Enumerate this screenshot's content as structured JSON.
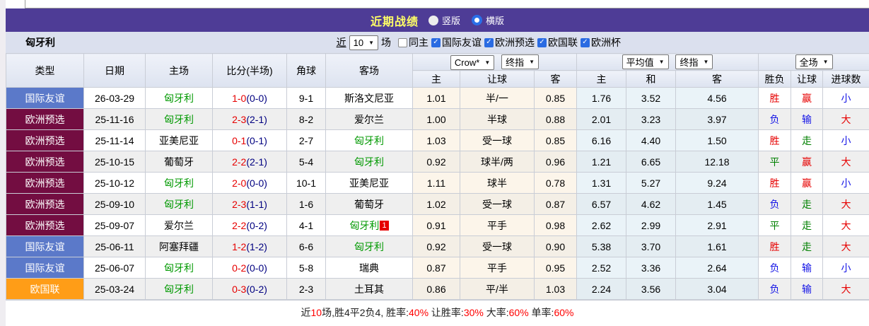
{
  "header": {
    "title": "近期战绩",
    "radio_vertical": "竖版",
    "radio_horizontal": "横版",
    "selected_mode": "横版"
  },
  "filter": {
    "team": "匈牙利",
    "near_label": "近",
    "games_value": "10",
    "games_suffix": "场",
    "checkboxes": [
      {
        "label": "同主",
        "checked": false
      },
      {
        "label": "国际友谊",
        "checked": true
      },
      {
        "label": "欧洲预选",
        "checked": true
      },
      {
        "label": "欧国联",
        "checked": true
      },
      {
        "label": "欧洲杯",
        "checked": true
      }
    ]
  },
  "table": {
    "team_name": "匈牙利",
    "static_headers": [
      "类型",
      "日期",
      "主场",
      "比分(半场)",
      "角球",
      "客场"
    ],
    "selects": {
      "crow_source": "Crow*",
      "crow_index": "终指",
      "avg_source": "平均值",
      "avg_index": "终指",
      "scope": "全场"
    },
    "sub_headers": [
      "主",
      "让球",
      "客",
      "主",
      "和",
      "客",
      "胜负",
      "让球",
      "进球数"
    ],
    "type_colors": {
      "国际友谊": "#5b79c9",
      "欧洲预选": "#730d41",
      "欧国联": "#ff9d17"
    },
    "rows": [
      {
        "type": "国际友谊",
        "date": "26-03-29",
        "home": "匈牙利",
        "score": "1-0",
        "half": "(0-0)",
        "corner": "9-1",
        "away": "斯洛文尼亚",
        "away_badge": "",
        "crow": [
          "1.01",
          "半/一",
          "0.85"
        ],
        "avg": [
          "1.76",
          "3.52",
          "4.56"
        ],
        "result": [
          [
            "胜",
            "red"
          ],
          [
            "赢",
            "red"
          ],
          [
            "小",
            "blue"
          ]
        ]
      },
      {
        "type": "欧洲预选",
        "date": "25-11-16",
        "home": "匈牙利",
        "score": "2-3",
        "half": "(2-1)",
        "corner": "8-2",
        "away": "爱尔兰",
        "away_badge": "",
        "crow": [
          "1.00",
          "半球",
          "0.88"
        ],
        "avg": [
          "2.01",
          "3.23",
          "3.97"
        ],
        "result": [
          [
            "负",
            "blue"
          ],
          [
            "输",
            "blue"
          ],
          [
            "大",
            "red"
          ]
        ]
      },
      {
        "type": "欧洲预选",
        "date": "25-11-14",
        "home": "亚美尼亚",
        "score": "0-1",
        "half": "(0-1)",
        "corner": "2-7",
        "away": "匈牙利",
        "away_badge": "",
        "crow": [
          "1.03",
          "受一球",
          "0.85"
        ],
        "avg": [
          "6.16",
          "4.40",
          "1.50"
        ],
        "result": [
          [
            "胜",
            "red"
          ],
          [
            "走",
            "green"
          ],
          [
            "小",
            "blue"
          ]
        ]
      },
      {
        "type": "欧洲预选",
        "date": "25-10-15",
        "home": "葡萄牙",
        "score": "2-2",
        "half": "(2-1)",
        "corner": "5-4",
        "away": "匈牙利",
        "away_badge": "",
        "crow": [
          "0.92",
          "球半/两",
          "0.96"
        ],
        "avg": [
          "1.21",
          "6.65",
          "12.18"
        ],
        "result": [
          [
            "平",
            "green"
          ],
          [
            "赢",
            "red"
          ],
          [
            "大",
            "red"
          ]
        ]
      },
      {
        "type": "欧洲预选",
        "date": "25-10-12",
        "home": "匈牙利",
        "score": "2-0",
        "half": "(0-0)",
        "corner": "10-1",
        "away": "亚美尼亚",
        "away_badge": "",
        "crow": [
          "1.11",
          "球半",
          "0.78"
        ],
        "avg": [
          "1.31",
          "5.27",
          "9.24"
        ],
        "result": [
          [
            "胜",
            "red"
          ],
          [
            "赢",
            "red"
          ],
          [
            "小",
            "blue"
          ]
        ]
      },
      {
        "type": "欧洲预选",
        "date": "25-09-10",
        "home": "匈牙利",
        "score": "2-3",
        "half": "(1-1)",
        "corner": "1-6",
        "away": "葡萄牙",
        "away_badge": "",
        "crow": [
          "1.02",
          "受一球",
          "0.87"
        ],
        "avg": [
          "6.57",
          "4.62",
          "1.45"
        ],
        "result": [
          [
            "负",
            "blue"
          ],
          [
            "走",
            "green"
          ],
          [
            "大",
            "red"
          ]
        ]
      },
      {
        "type": "欧洲预选",
        "date": "25-09-07",
        "home": "爱尔兰",
        "score": "2-2",
        "half": "(0-2)",
        "corner": "4-1",
        "away": "匈牙利",
        "away_badge": "1",
        "crow": [
          "0.91",
          "平手",
          "0.98"
        ],
        "avg": [
          "2.62",
          "2.99",
          "2.91"
        ],
        "result": [
          [
            "平",
            "green"
          ],
          [
            "走",
            "green"
          ],
          [
            "大",
            "red"
          ]
        ]
      },
      {
        "type": "国际友谊",
        "date": "25-06-11",
        "home": "阿塞拜疆",
        "score": "1-2",
        "half": "(1-2)",
        "corner": "6-6",
        "away": "匈牙利",
        "away_badge": "",
        "crow": [
          "0.92",
          "受一球",
          "0.90"
        ],
        "avg": [
          "5.38",
          "3.70",
          "1.61"
        ],
        "result": [
          [
            "胜",
            "red"
          ],
          [
            "走",
            "green"
          ],
          [
            "大",
            "red"
          ]
        ]
      },
      {
        "type": "国际友谊",
        "date": "25-06-07",
        "home": "匈牙利",
        "score": "0-2",
        "half": "(0-0)",
        "corner": "5-8",
        "away": "瑞典",
        "away_badge": "",
        "crow": [
          "0.87",
          "平手",
          "0.95"
        ],
        "avg": [
          "2.52",
          "3.36",
          "2.64"
        ],
        "result": [
          [
            "负",
            "blue"
          ],
          [
            "输",
            "blue"
          ],
          [
            "小",
            "blue"
          ]
        ]
      },
      {
        "type": "欧国联",
        "date": "25-03-24",
        "home": "匈牙利",
        "score": "0-3",
        "half": "(0-2)",
        "corner": "2-3",
        "away": "土耳其",
        "away_badge": "",
        "crow": [
          "0.86",
          "平/半",
          "1.03"
        ],
        "avg": [
          "2.24",
          "3.56",
          "3.04"
        ],
        "result": [
          [
            "负",
            "blue"
          ],
          [
            "输",
            "blue"
          ],
          [
            "大",
            "red"
          ]
        ]
      }
    ]
  },
  "footer": {
    "segments": [
      [
        "近",
        "black"
      ],
      [
        "10",
        "red"
      ],
      [
        "场,胜4平2负4, 胜率:",
        "black"
      ],
      [
        "40%",
        "red"
      ],
      [
        " 让胜率:",
        "black"
      ],
      [
        "30%",
        "red"
      ],
      [
        " 大率:",
        "black"
      ],
      [
        "60%",
        "red"
      ],
      [
        " 单率:",
        "black"
      ],
      [
        "60%",
        "red"
      ]
    ]
  },
  "colors": {
    "title_bar": "#4e3c96",
    "title_text": "#ffff66",
    "team_link": "#009900",
    "score_main": "#e60000",
    "score_half": "#000080",
    "result_red": "#e60000",
    "result_blue": "#1414e6",
    "result_green": "#008000"
  }
}
